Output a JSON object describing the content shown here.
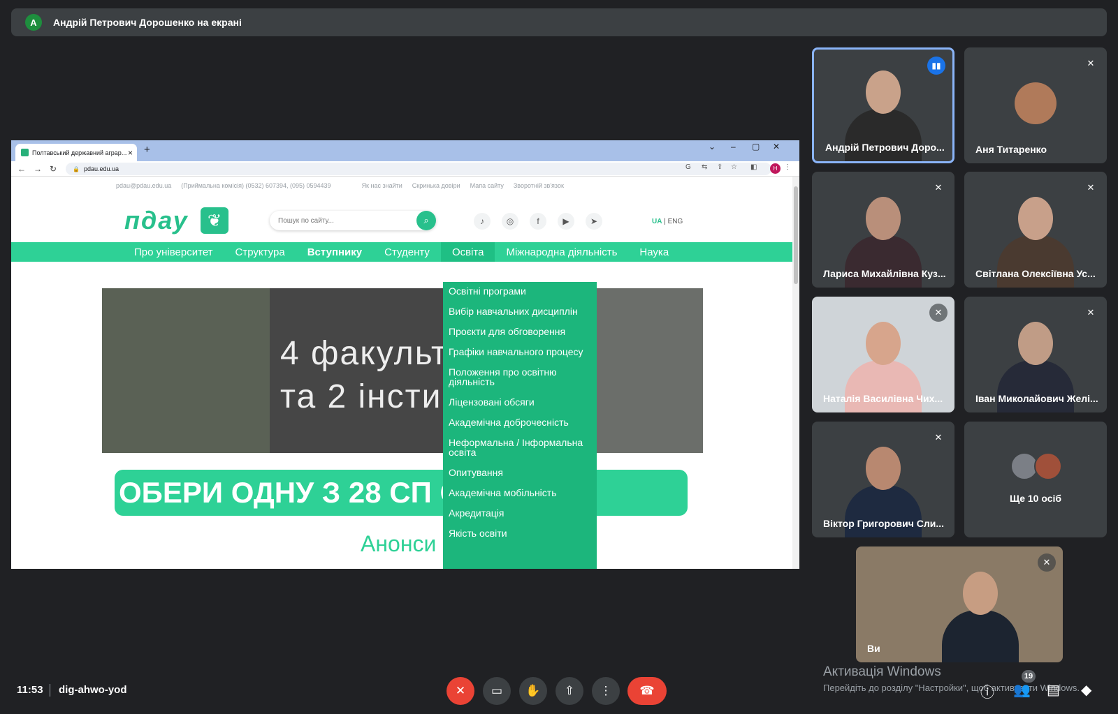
{
  "banner": {
    "avatar_letter": "А",
    "text": "Андрій Петрович Дорошенко на екрані"
  },
  "browser": {
    "tab_title": "Полтавський державний аграр...",
    "tab_close": "×",
    "new_tab": "+",
    "url": "pdau.edu.ua",
    "profile_letter": "H"
  },
  "site": {
    "topline": [
      "pdau@pdau.edu.ua",
      "(Приймальна комісія) (0532) 607394, (095) 0594439",
      "Як нас знайти",
      "Скринька довіри",
      "Мапа сайту",
      "Зворотній зв'язок"
    ],
    "logo": "пдау",
    "search_placeholder": "Пошук по сайту...",
    "lang_ua": "UA",
    "lang_en": "ENG",
    "nav": [
      "Про університет",
      "Структура",
      "Вступнику",
      "Студенту",
      "Освіта",
      "Міжнародна діяльність",
      "Наука"
    ],
    "hero_line1": "4 факульт",
    "hero_line2": "та 2 інсти",
    "promo": "ОБЕРИ ОДНУ З 28 СП            ОСТЕЙ",
    "announce": "Анонси",
    "dropdown": [
      "Освітні програми",
      "Вибір навчальних дисциплін",
      "Проєкти для обговорення",
      "Графіки навчального процесу",
      "Положення про освітню діяльність",
      "Ліцензовані обсяги",
      "Академічна доброчесність",
      "Неформальна / Інформальна освіта",
      "Опитування",
      "Академічна мобільність",
      "Акредитація",
      "Якість освіти"
    ]
  },
  "participants": [
    {
      "name": "Андрій Петрович Доро...",
      "status": "speaking"
    },
    {
      "name": "Аня Титаренко",
      "status": "muted"
    },
    {
      "name": "Лариса Михайлівна Куз...",
      "status": "muted"
    },
    {
      "name": "Світлана Олексіївна Ус...",
      "status": "muted"
    },
    {
      "name": "Наталія Василівна Чих...",
      "status": "muted"
    },
    {
      "name": "Іван Миколайович Желі...",
      "status": "muted"
    },
    {
      "name": "Віктор Григорович Сли...",
      "status": "muted"
    },
    {
      "name": "Ще 10 осіб",
      "status": "overflow"
    },
    {
      "name": "Ви",
      "status": "muted"
    }
  ],
  "bottom": {
    "time": "11:53",
    "meeting_code": "dig-ahwo-yod",
    "people_count": "19",
    "activation_title": "Активація Windows",
    "activation_text": "Перейдіть до розділу \"Настройки\", щоб активувати Windows."
  },
  "colors": {
    "meet_bg": "#202124",
    "site_green": "#2ed196",
    "dropdown_green": "#1cb67c",
    "end_call": "#ea4335",
    "speaking": "#1a73e8"
  }
}
